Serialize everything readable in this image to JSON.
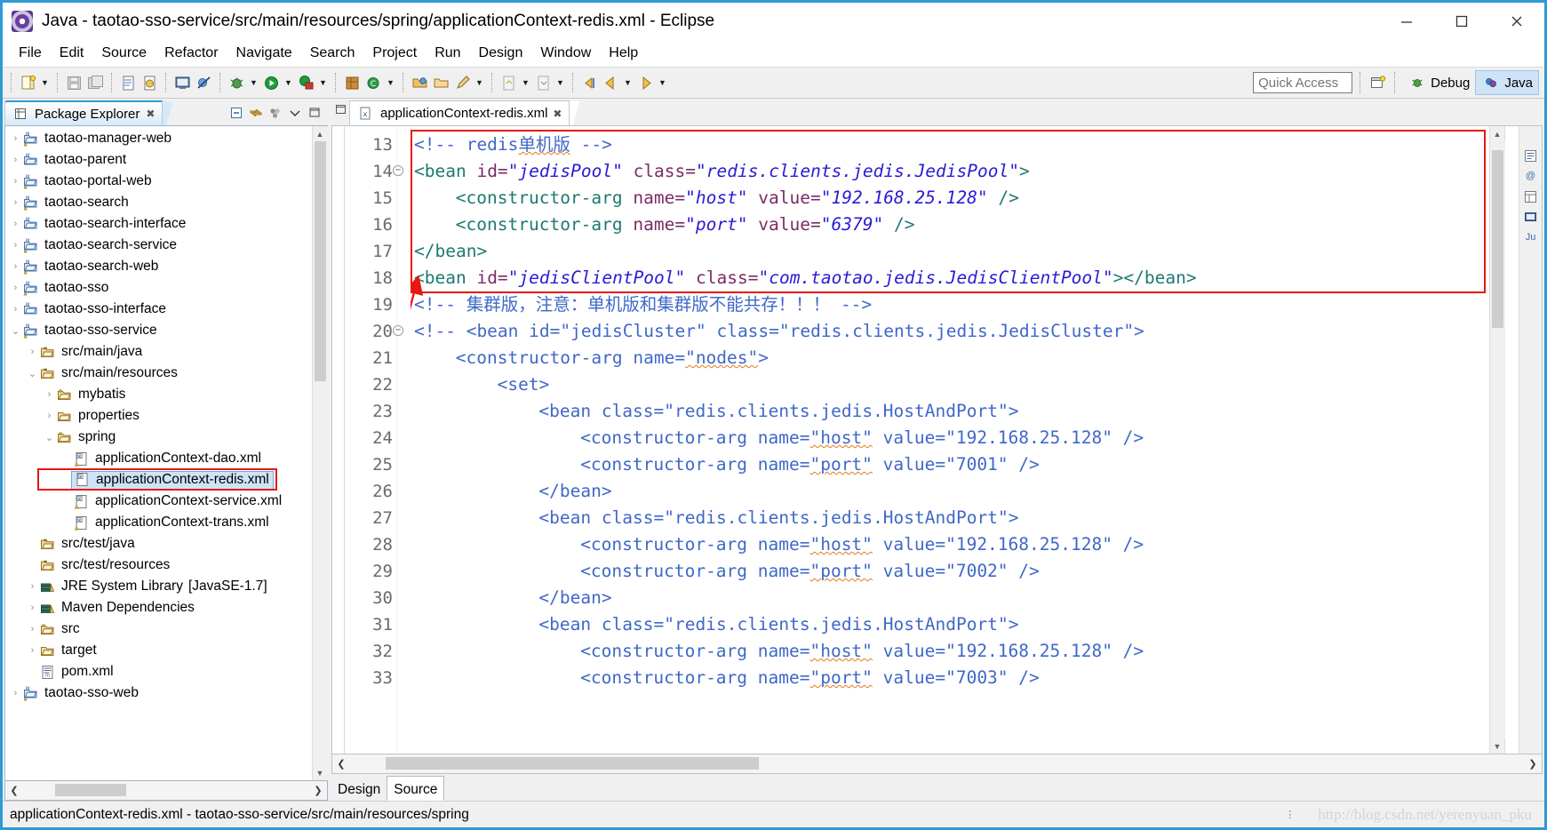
{
  "window": {
    "title": "Java - taotao-sso-service/src/main/resources/spring/applicationContext-redis.xml - Eclipse",
    "app_icon": "eclipse-icon",
    "minimize": "—",
    "maximize": "☐",
    "close": "✕"
  },
  "menubar": {
    "items": [
      "File",
      "Edit",
      "Source",
      "Refactor",
      "Navigate",
      "Search",
      "Project",
      "Run",
      "Design",
      "Window",
      "Help"
    ]
  },
  "toolbar": {
    "quick_access_placeholder": "Quick Access",
    "perspective_open_label": "",
    "debug_label": "Debug",
    "java_label": "Java",
    "dropdown_glyph": "▼"
  },
  "explorer": {
    "tab_title": "Package Explorer",
    "tab_close": "✖",
    "tools": [
      "collapse-all-icon",
      "link-with-editor-icon",
      "focus-icon",
      "view-menu-icon",
      "minimize-icon",
      "maximize-icon"
    ],
    "tree": [
      {
        "label": "taotao-manager-web",
        "indent": 0,
        "twist": "›",
        "icon": "maven-project-warn-icon"
      },
      {
        "label": "taotao-parent",
        "indent": 0,
        "twist": "›",
        "icon": "maven-project-icon"
      },
      {
        "label": "taotao-portal-web",
        "indent": 0,
        "twist": "›",
        "icon": "maven-project-warn-icon"
      },
      {
        "label": "taotao-search",
        "indent": 0,
        "twist": "›",
        "icon": "maven-project-warn-icon"
      },
      {
        "label": "taotao-search-interface",
        "indent": 0,
        "twist": "›",
        "icon": "maven-project-icon"
      },
      {
        "label": "taotao-search-service",
        "indent": 0,
        "twist": "›",
        "icon": "maven-project-warn-icon"
      },
      {
        "label": "taotao-search-web",
        "indent": 0,
        "twist": "›",
        "icon": "maven-project-warn-icon"
      },
      {
        "label": "taotao-sso",
        "indent": 0,
        "twist": "›",
        "icon": "maven-project-warn-icon"
      },
      {
        "label": "taotao-sso-interface",
        "indent": 0,
        "twist": "›",
        "icon": "maven-project-icon"
      },
      {
        "label": "taotao-sso-service",
        "indent": 0,
        "twist": "⌄",
        "icon": "maven-project-warn-icon"
      },
      {
        "label": "src/main/java",
        "indent": 1,
        "twist": "›",
        "icon": "source-folder-icon"
      },
      {
        "label": "src/main/resources",
        "indent": 1,
        "twist": "⌄",
        "icon": "source-folder-icon"
      },
      {
        "label": "mybatis",
        "indent": 2,
        "twist": "›",
        "icon": "package-icon"
      },
      {
        "label": "properties",
        "indent": 2,
        "twist": "›",
        "icon": "folder-icon"
      },
      {
        "label": "spring",
        "indent": 2,
        "twist": "⌄",
        "icon": "package-icon"
      },
      {
        "label": "applicationContext-dao.xml",
        "indent": 3,
        "twist": "",
        "icon": "xml-file-warn-icon"
      },
      {
        "label": "applicationContext-redis.xml",
        "indent": 3,
        "twist": "",
        "icon": "xml-file-icon",
        "selected": true
      },
      {
        "label": "applicationContext-service.xml",
        "indent": 3,
        "twist": "",
        "icon": "xml-file-warn-icon"
      },
      {
        "label": "applicationContext-trans.xml",
        "indent": 3,
        "twist": "",
        "icon": "xml-file-warn-icon"
      },
      {
        "label": "src/test/java",
        "indent": 1,
        "twist": "",
        "icon": "source-folder-icon"
      },
      {
        "label": "src/test/resources",
        "indent": 1,
        "twist": "",
        "icon": "source-folder-icon"
      },
      {
        "label": "JRE System Library",
        "indent": 1,
        "twist": "›",
        "icon": "library-icon",
        "dim": "[JavaSE-1.7]"
      },
      {
        "label": "Maven Dependencies",
        "indent": 1,
        "twist": "›",
        "icon": "library-icon"
      },
      {
        "label": "src",
        "indent": 1,
        "twist": "›",
        "icon": "package-icon"
      },
      {
        "label": "target",
        "indent": 1,
        "twist": "›",
        "icon": "folder-icon"
      },
      {
        "label": "pom.xml",
        "indent": 1,
        "twist": "",
        "icon": "pom-file-icon"
      },
      {
        "label": "taotao-sso-web",
        "indent": 0,
        "twist": "›",
        "icon": "maven-project-warn-icon"
      }
    ]
  },
  "editor": {
    "tab_title": "applicationContext-redis.xml",
    "tab_icon": "xml-file-icon",
    "tab_close": "✖",
    "bottom_tabs": [
      {
        "label": "Design",
        "active": false
      },
      {
        "label": "Source",
        "active": true
      }
    ],
    "first_line_number": 13,
    "lines": [
      {
        "n": 13,
        "fold": false,
        "indent": 0,
        "tokens": [
          {
            "t": "comment",
            "v": "<!-- redis"
          },
          {
            "t": "comment-squig",
            "v": "单机版"
          },
          {
            "t": "comment",
            "v": " -->"
          }
        ]
      },
      {
        "n": 14,
        "fold": true,
        "indent": 0,
        "tokens": [
          {
            "t": "tag",
            "v": "<bean "
          },
          {
            "t": "attr",
            "v": "id="
          },
          {
            "t": "val",
            "v": "\"jedisPool\""
          },
          {
            "t": "plain",
            "v": " "
          },
          {
            "t": "attr",
            "v": "class="
          },
          {
            "t": "val",
            "v": "\"redis.clients.jedis.JedisPool\""
          },
          {
            "t": "tag",
            "v": ">"
          }
        ]
      },
      {
        "n": 15,
        "fold": false,
        "indent": 4,
        "tokens": [
          {
            "t": "tag",
            "v": "<constructor-arg "
          },
          {
            "t": "attr",
            "v": "name="
          },
          {
            "t": "val",
            "v": "\"host\""
          },
          {
            "t": "plain",
            "v": " "
          },
          {
            "t": "attr",
            "v": "value="
          },
          {
            "t": "val",
            "v": "\"192.168.25.128\""
          },
          {
            "t": "plain",
            "v": " "
          },
          {
            "t": "tag",
            "v": "/>"
          }
        ]
      },
      {
        "n": 16,
        "fold": false,
        "indent": 4,
        "tokens": [
          {
            "t": "tag",
            "v": "<constructor-arg "
          },
          {
            "t": "attr",
            "v": "name="
          },
          {
            "t": "val",
            "v": "\"port\""
          },
          {
            "t": "plain",
            "v": " "
          },
          {
            "t": "attr",
            "v": "value="
          },
          {
            "t": "val",
            "v": "\"6379\""
          },
          {
            "t": "plain",
            "v": " "
          },
          {
            "t": "tag",
            "v": "/>"
          }
        ]
      },
      {
        "n": 17,
        "fold": false,
        "indent": 0,
        "tokens": [
          {
            "t": "tag",
            "v": "</bean>"
          }
        ]
      },
      {
        "n": 18,
        "fold": false,
        "indent": 0,
        "tokens": [
          {
            "t": "tag",
            "v": "<bean "
          },
          {
            "t": "attr",
            "v": "id="
          },
          {
            "t": "val",
            "v": "\"jedisClientPool\""
          },
          {
            "t": "plain",
            "v": " "
          },
          {
            "t": "attr",
            "v": "class="
          },
          {
            "t": "val",
            "v": "\"com.taotao.jedis.JedisClientPool\""
          },
          {
            "t": "tag",
            "v": "></bean>"
          }
        ]
      },
      {
        "n": 19,
        "fold": false,
        "indent": 0,
        "tokens": [
          {
            "t": "comment",
            "v": "<!-- 集群版，注意：单机版和集群版不能共存！！！ -->"
          }
        ]
      },
      {
        "n": 20,
        "fold": true,
        "indent": 0,
        "tokens": [
          {
            "t": "comment",
            "v": "<!-- <bean id=\"jedisCluster\" class=\"redis.clients.jedis.JedisCluster\">"
          }
        ]
      },
      {
        "n": 21,
        "fold": false,
        "indent": 4,
        "tokens": [
          {
            "t": "comment",
            "v": "<constructor-arg name="
          },
          {
            "t": "comment-squig",
            "v": "\"nodes\""
          },
          {
            "t": "comment",
            "v": ">"
          }
        ]
      },
      {
        "n": 22,
        "fold": false,
        "indent": 8,
        "tokens": [
          {
            "t": "comment",
            "v": "<set>"
          }
        ]
      },
      {
        "n": 23,
        "fold": false,
        "indent": 12,
        "tokens": [
          {
            "t": "comment",
            "v": "<bean class=\"redis.clients.jedis.HostAndPort\">"
          }
        ]
      },
      {
        "n": 24,
        "fold": false,
        "indent": 16,
        "tokens": [
          {
            "t": "comment",
            "v": "<constructor-arg name="
          },
          {
            "t": "comment-squig",
            "v": "\"host\""
          },
          {
            "t": "comment",
            "v": " value=\"192.168.25.128\" />"
          }
        ]
      },
      {
        "n": 25,
        "fold": false,
        "indent": 16,
        "tokens": [
          {
            "t": "comment",
            "v": "<constructor-arg name="
          },
          {
            "t": "comment-squig",
            "v": "\"port\""
          },
          {
            "t": "comment",
            "v": " value=\"7001\" />"
          }
        ]
      },
      {
        "n": 26,
        "fold": false,
        "indent": 12,
        "tokens": [
          {
            "t": "comment",
            "v": "</bean>"
          }
        ]
      },
      {
        "n": 27,
        "fold": false,
        "indent": 12,
        "tokens": [
          {
            "t": "comment",
            "v": "<bean class=\"redis.clients.jedis.HostAndPort\">"
          }
        ]
      },
      {
        "n": 28,
        "fold": false,
        "indent": 16,
        "tokens": [
          {
            "t": "comment",
            "v": "<constructor-arg name="
          },
          {
            "t": "comment-squig",
            "v": "\"host\""
          },
          {
            "t": "comment",
            "v": " value=\"192.168.25.128\" />"
          }
        ]
      },
      {
        "n": 29,
        "fold": false,
        "indent": 16,
        "tokens": [
          {
            "t": "comment",
            "v": "<constructor-arg name="
          },
          {
            "t": "comment-squig",
            "v": "\"port\""
          },
          {
            "t": "comment",
            "v": " value=\"7002\" />"
          }
        ]
      },
      {
        "n": 30,
        "fold": false,
        "indent": 12,
        "tokens": [
          {
            "t": "comment",
            "v": "</bean>"
          }
        ]
      },
      {
        "n": 31,
        "fold": false,
        "indent": 12,
        "tokens": [
          {
            "t": "comment",
            "v": "<bean class=\"redis.clients.jedis.HostAndPort\">"
          }
        ]
      },
      {
        "n": 32,
        "fold": false,
        "indent": 16,
        "tokens": [
          {
            "t": "comment",
            "v": "<constructor-arg name="
          },
          {
            "t": "comment-squig",
            "v": "\"host\""
          },
          {
            "t": "comment",
            "v": " value=\"192.168.25.128\" />"
          }
        ]
      },
      {
        "n": 33,
        "fold": false,
        "indent": 16,
        "tokens": [
          {
            "t": "comment",
            "v": "<constructor-arg name="
          },
          {
            "t": "comment-squig",
            "v": "\"port\""
          },
          {
            "t": "comment",
            "v": " value=\"7003\" />"
          }
        ]
      }
    ]
  },
  "statusbar": {
    "text": "applicationContext-redis.xml - taotao-sso-service/src/main/resources/spring",
    "watermark": "http://blog.csdn.net/yerenyuan_pku"
  },
  "annotation": {
    "color": "#e8170f",
    "description": "red-highlight-and-arrow"
  }
}
